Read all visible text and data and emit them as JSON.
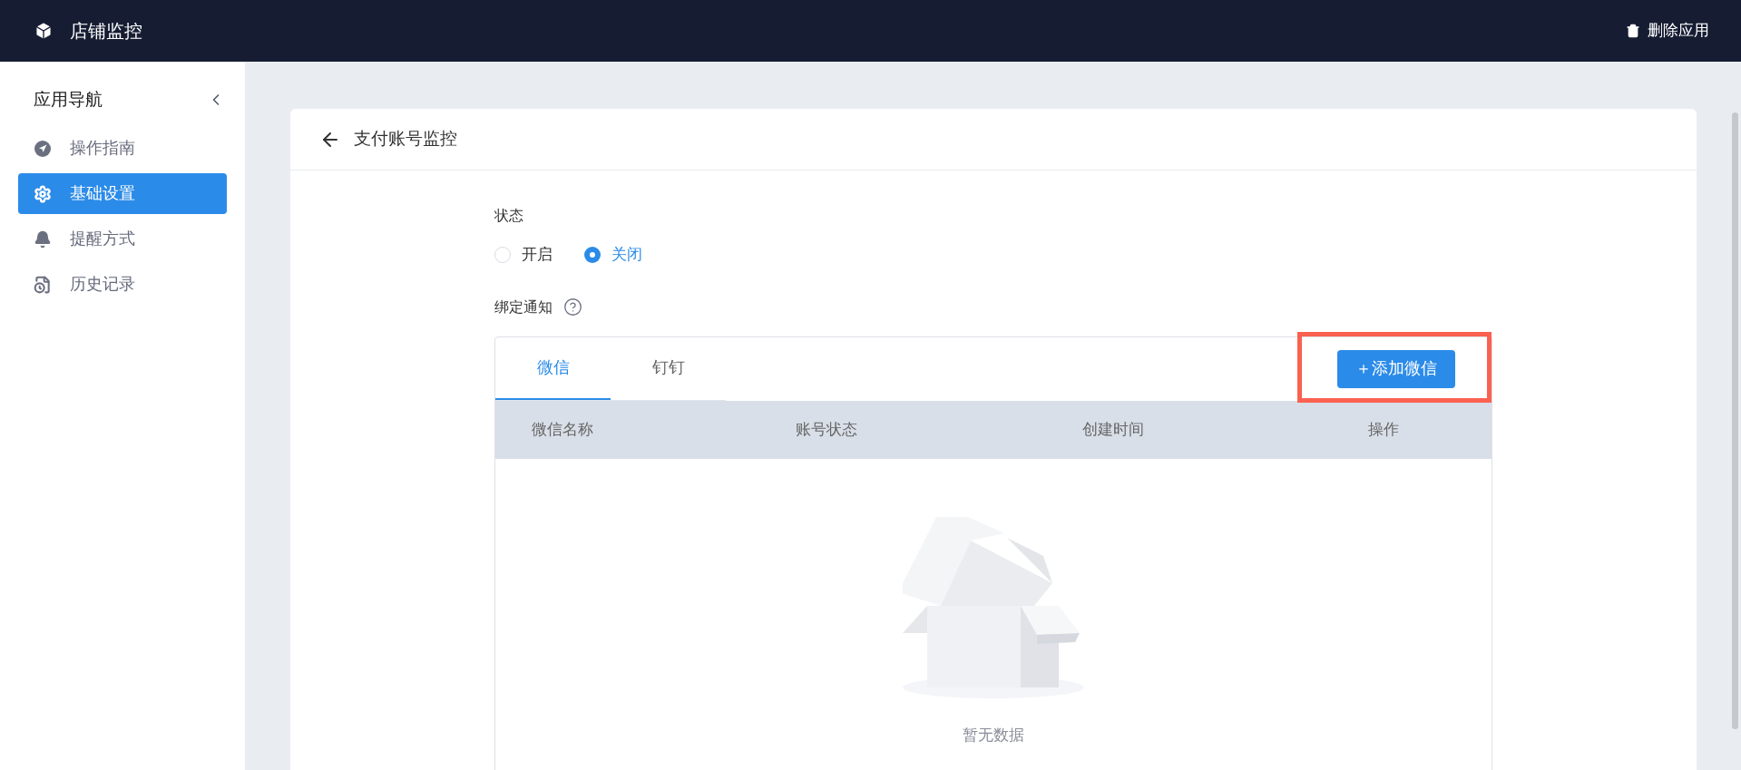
{
  "app": {
    "title": "店铺监控",
    "delete_label": "删除应用"
  },
  "sidebar": {
    "title": "应用导航",
    "items": [
      {
        "label": "操作指南",
        "kind": "guide",
        "selected": false
      },
      {
        "label": "基础设置",
        "kind": "settings",
        "selected": true
      },
      {
        "label": "提醒方式",
        "kind": "alert",
        "selected": false
      },
      {
        "label": "历史记录",
        "kind": "history",
        "selected": false
      }
    ]
  },
  "page": {
    "title": "支付账号监控"
  },
  "status": {
    "label": "状态",
    "options": [
      {
        "label": "开启",
        "selected": false
      },
      {
        "label": "关闭",
        "selected": true
      }
    ]
  },
  "binding": {
    "label": "绑定通知",
    "tabs": [
      {
        "label": "微信",
        "selected": true
      },
      {
        "label": "钉钉",
        "selected": false
      }
    ],
    "add_button": {
      "label": "＋添加微信",
      "highlighted": true
    },
    "columns": [
      "微信名称",
      "账号状态",
      "创建时间",
      "操作"
    ],
    "empty_text": "暂无数据"
  }
}
